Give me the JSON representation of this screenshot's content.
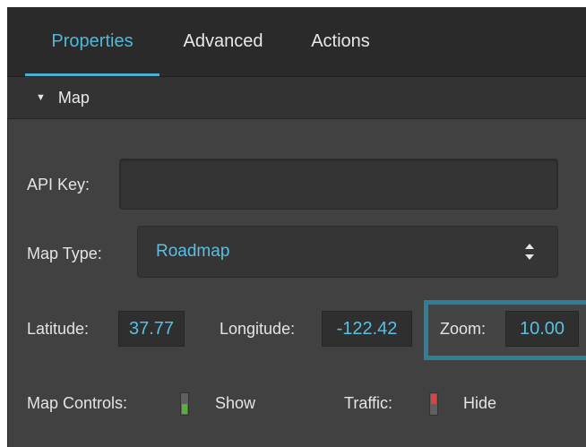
{
  "tabs": {
    "properties": "Properties",
    "advanced": "Advanced",
    "actions": "Actions"
  },
  "section": {
    "title": "Map"
  },
  "fields": {
    "api_key_label": "API Key:",
    "api_key_value": "",
    "map_type_label": "Map Type:",
    "map_type_value": "Roadmap",
    "latitude_label": "Latitude:",
    "latitude_value": "37.77",
    "longitude_label": "Longitude:",
    "longitude_value": "-122.42",
    "zoom_label": "Zoom:",
    "zoom_value": "10.00",
    "map_controls_label": "Map Controls:",
    "map_controls_state": "Show",
    "traffic_label": "Traffic:",
    "traffic_state": "Hide"
  },
  "colors": {
    "accent": "#4fb8d8",
    "highlight": "#2f7f98",
    "toggle_on": "#58b038",
    "toggle_off": "#d44646"
  }
}
